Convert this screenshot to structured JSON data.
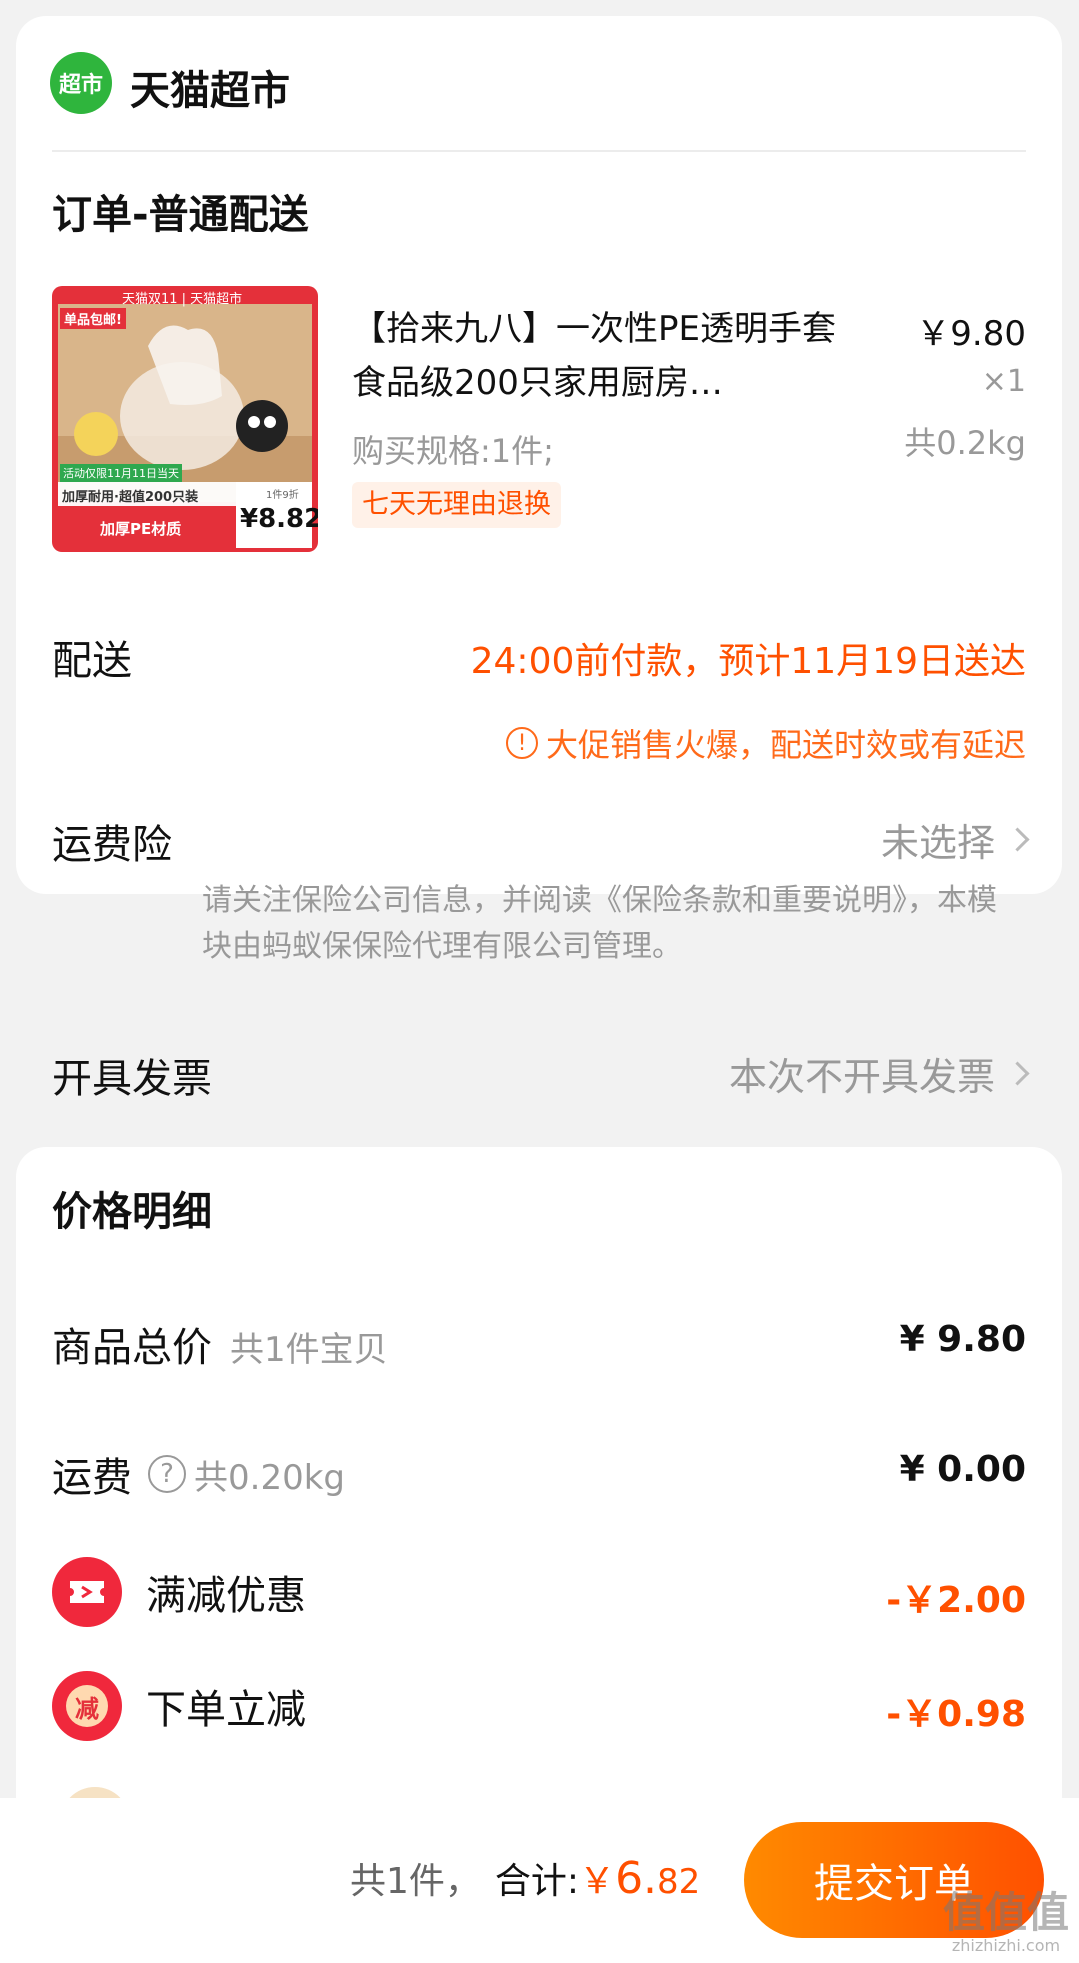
{
  "store": {
    "logo_text": "超市",
    "name": "天猫超市"
  },
  "order": {
    "section_title": "订单-普通配送"
  },
  "product": {
    "image_badges": {
      "top_banner": "天猫双11 | 天猫超市",
      "corner_tag": "单品包邮!",
      "activity": "活动仅限11月11日当天",
      "feature": "加厚耐用·超值200只装",
      "material": "加厚PE材质",
      "discount_note": "1件9折",
      "promo_price": "¥8.82"
    },
    "title": "【拾来九八】一次性PE透明手套食品级200只家用厨房…",
    "price": "￥9.80",
    "qty": "×1",
    "weight": "共0.2kg",
    "spec": "购买规格:1件;",
    "tag": "七天无理由退换"
  },
  "delivery": {
    "label": "配送",
    "value": "24:00前付款，预计11月19日送达",
    "note_icon": "!",
    "note": "大促销售火爆，配送时效或有延迟"
  },
  "insurance": {
    "label": "运费险",
    "value": "未选择",
    "note": "请关注保险公司信息，并阅读《保险条款和重要说明》，本模块由蚂蚁保保险代理有限公司管理。"
  },
  "invoice": {
    "label": "开具发票",
    "value": "本次不开具发票"
  },
  "price_details": {
    "title": "价格明细",
    "goods_total": {
      "label": "商品总价",
      "sub": "共1件宝贝",
      "value": "¥ 9.80"
    },
    "shipping": {
      "label": "运费",
      "icon": "?",
      "sub": "共0.20kg",
      "value": "¥ 0.00"
    },
    "full_reduction": {
      "label": "满减优惠",
      "value": "-￥2.00"
    },
    "instant_reduction": {
      "label": "下单立减",
      "icon_text": "减",
      "value": "-￥0.98"
    }
  },
  "footer": {
    "count": "共1件，",
    "total_label": "合计:",
    "currency": "￥",
    "total_int": "6.",
    "total_dec": "82",
    "submit": "提交订单"
  },
  "watermark": {
    "text": "值值值",
    "url": "zhizhizhi.com"
  },
  "colors": {
    "accent": "#ff5000",
    "store_green": "#2fb53d",
    "promo_red": "#f0283c"
  }
}
